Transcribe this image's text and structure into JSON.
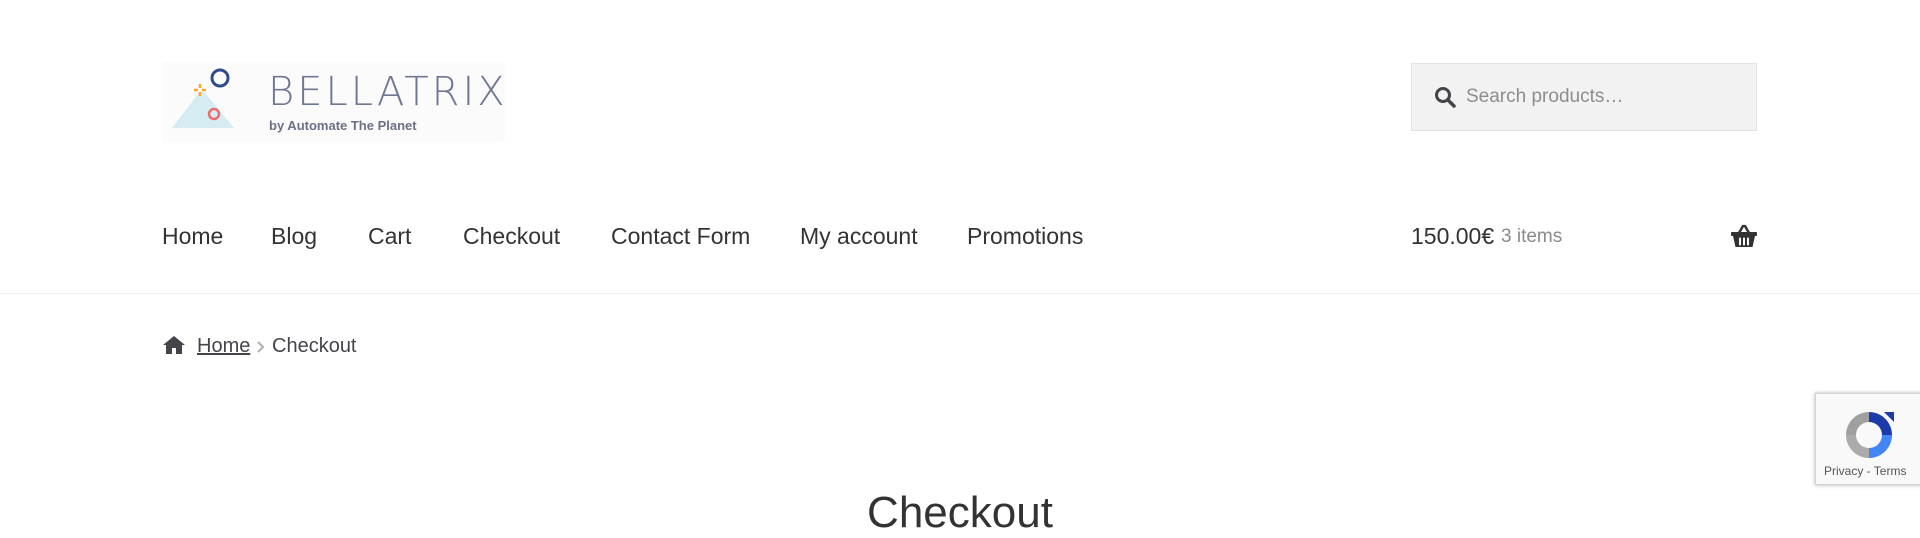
{
  "header": {
    "logo": {
      "title": "BELLATRIX",
      "subtitle": "by Automate The Planet"
    },
    "search": {
      "placeholder": "Search products…",
      "value": ""
    }
  },
  "nav": {
    "items": [
      {
        "label": "Home"
      },
      {
        "label": "Blog"
      },
      {
        "label": "Cart"
      },
      {
        "label": "Checkout"
      },
      {
        "label": "Contact Form"
      },
      {
        "label": "My account"
      },
      {
        "label": "Promotions"
      }
    ]
  },
  "cart": {
    "amount": "150.00€",
    "count": "3 items",
    "icon": "basket-icon"
  },
  "breadcrumb": {
    "home_icon": "home-icon",
    "home_label": "Home",
    "separator_icon": "chevron-right-icon",
    "current": "Checkout"
  },
  "main": {
    "page_title": "Checkout"
  },
  "recaptcha": {
    "privacy": "Privacy",
    "separator": " - ",
    "terms": "Terms"
  },
  "colors": {
    "text": "#43454b",
    "nav_text": "#333333",
    "logo_text": "#6f7793",
    "logo_blue": "#2d4b8c",
    "logo_red": "#ec6b6b",
    "logo_orange": "#f5a623",
    "logo_mountain": "#d6ecf3",
    "search_bg": "#f2f2f2"
  }
}
